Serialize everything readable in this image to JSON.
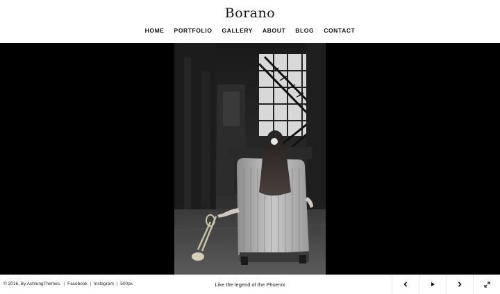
{
  "site": {
    "title": "Borano"
  },
  "nav": {
    "items": [
      {
        "label": "HOME"
      },
      {
        "label": "PORTFOLIO"
      },
      {
        "label": "GALLERY"
      },
      {
        "label": "ABOUT"
      },
      {
        "label": "BLOG"
      },
      {
        "label": "CONTACT"
      }
    ]
  },
  "slide": {
    "caption": "Like the legend of the Phoenix"
  },
  "footer": {
    "copyright": "© 2016. By AchtungThemes.",
    "separator": "|",
    "links": [
      "Facebook",
      "Instagram",
      "500px"
    ]
  },
  "controls": {
    "prev_icon": "chevron-left-icon",
    "play_icon": "play-icon",
    "next_icon": "chevron-right-icon",
    "fullscreen_icon": "expand-icon"
  },
  "colors": {
    "stage_bg": "#000000",
    "header_bg": "#ffffff",
    "text": "#111111"
  }
}
